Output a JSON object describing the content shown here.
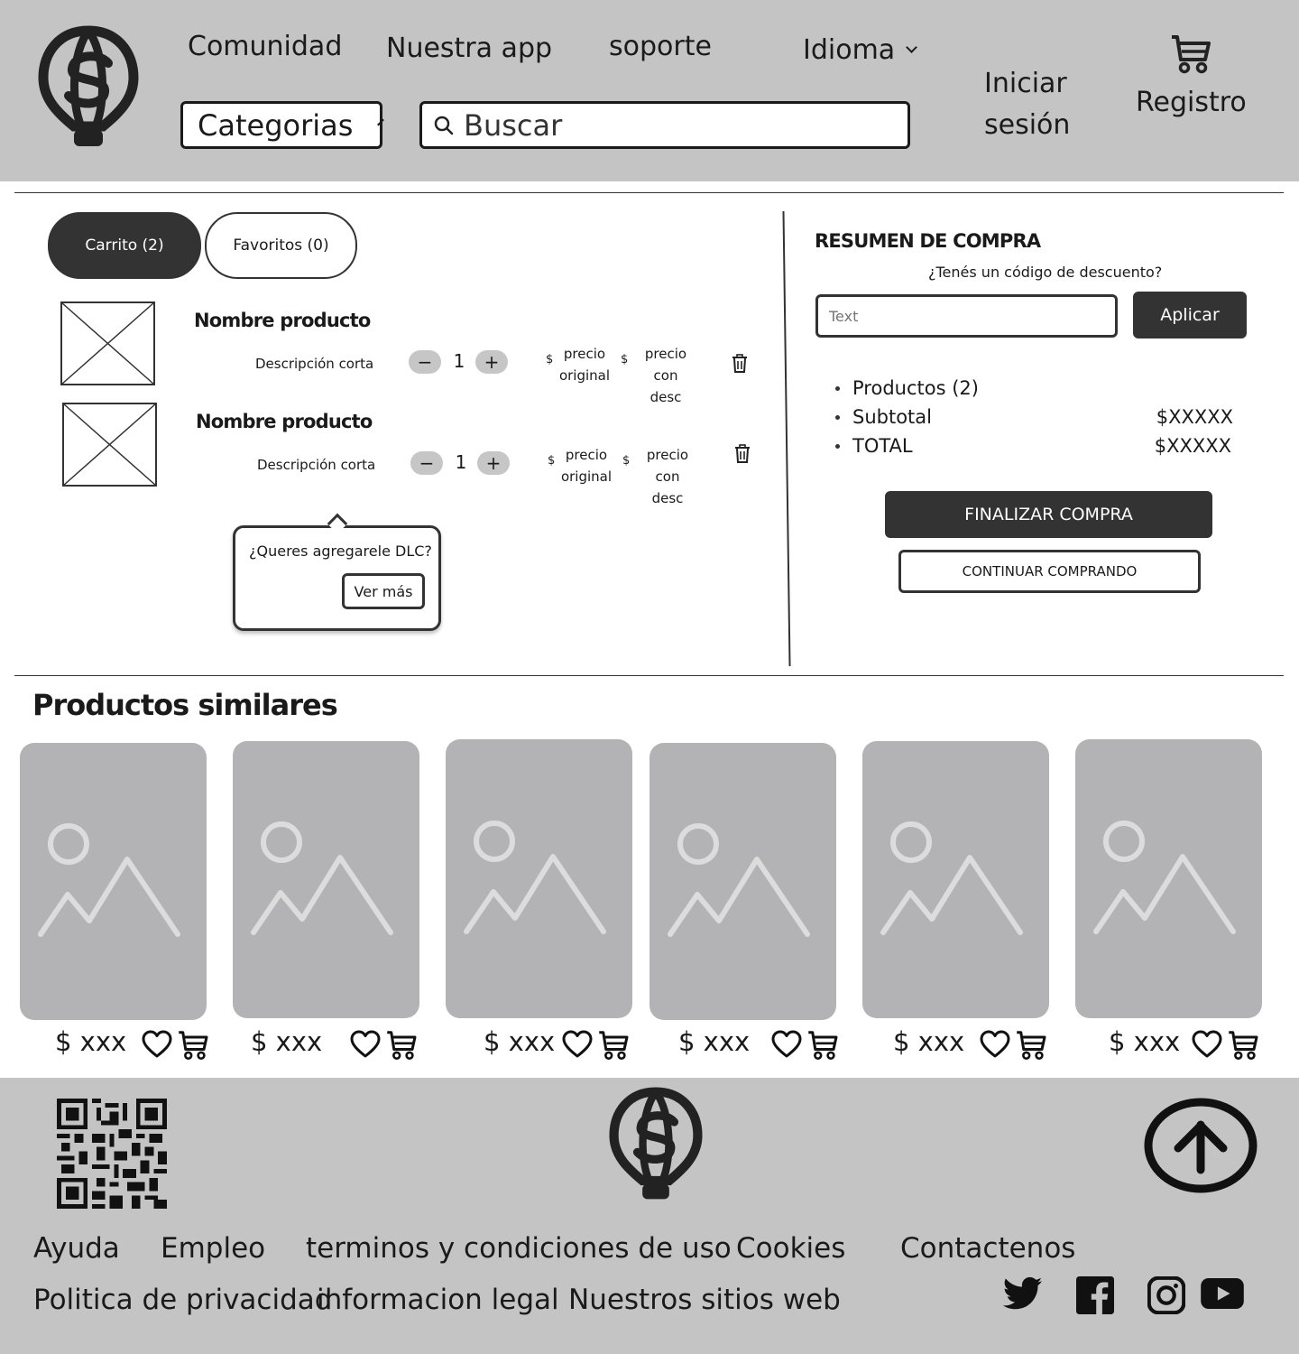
{
  "header": {
    "nav": [
      "Comunidad",
      "Nuestra app",
      "soporte"
    ],
    "language_label": "Idioma",
    "categories_label": "Categorias",
    "search_placeholder": "Buscar",
    "login_line1": "Iniciar",
    "login_line2": "sesión",
    "register_label": "Registro"
  },
  "cart": {
    "tabs": [
      {
        "label": "Carrito (2)",
        "active": true
      },
      {
        "label": "Favoritos (0)",
        "active": false
      }
    ],
    "items": [
      {
        "name": "Nombre producto",
        "description": "Descripción corta",
        "quantity": "1",
        "currency": "$",
        "price_original_1": "precio",
        "price_original_2": "original",
        "price_discount_1": "precio con",
        "price_discount_2": "desc"
      },
      {
        "name": "Nombre producto",
        "description": "Descripción corta",
        "quantity": "1",
        "currency": "$",
        "price_original_1": "precio",
        "price_original_2": "original",
        "price_discount_1": "precio con",
        "price_discount_2": "desc"
      }
    ],
    "dlc_popover": {
      "question": "¿Queres agregarele DLC?",
      "button": "Ver más"
    }
  },
  "summary": {
    "title": "RESUMEN DE COMPRA",
    "discount_question": "¿Tenés un código de descuento?",
    "discount_placeholder": "Text",
    "apply_button": "Aplicar",
    "rows": [
      {
        "label": "Productos (2)",
        "value": ""
      },
      {
        "label": "Subtotal",
        "value": "$XXXXX"
      },
      {
        "label": "TOTAL",
        "value": "$XXXXX"
      }
    ],
    "checkout_button": "FINALIZAR COMPRA",
    "continue_button": "CONTINUAR COMPRANDO"
  },
  "similar": {
    "title": "Productos similares",
    "products": [
      {
        "price": "$ xxx"
      },
      {
        "price": "$ xxx"
      },
      {
        "price": "$ xxx"
      },
      {
        "price": "$ xxx"
      },
      {
        "price": "$ xxx"
      },
      {
        "price": "$ xxx"
      }
    ]
  },
  "footer": {
    "links_row1": [
      "Ayuda",
      "Empleo",
      "terminos y condiciones de uso",
      "Cookies",
      "Contactenos"
    ],
    "links_row2": [
      "Politica de privacidad",
      "informacion legal",
      "Nuestros sitios web"
    ],
    "social_icons": [
      "twitter-icon",
      "facebook-icon",
      "instagram-icon",
      "youtube-icon"
    ]
  },
  "colors": {
    "header_bg": "#c4c4c4",
    "dark": "#333333",
    "placeholder_bg": "#b3b3b5",
    "placeholder_fg": "#dcdcdc"
  }
}
